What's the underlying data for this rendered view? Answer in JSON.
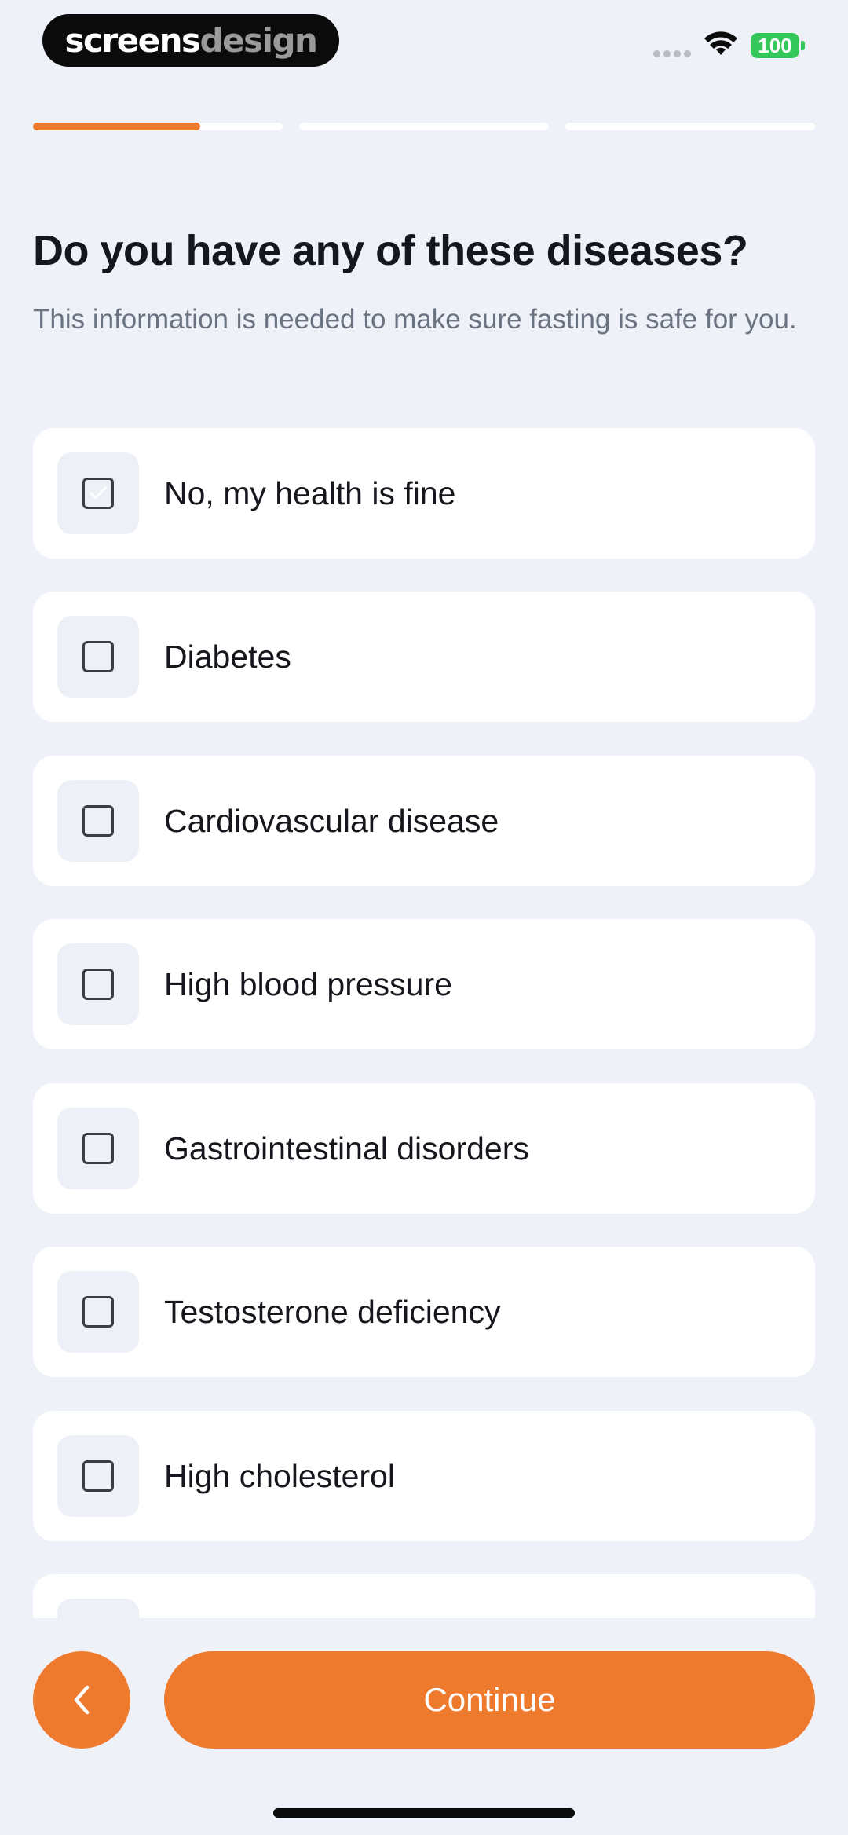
{
  "status_bar": {
    "brand_part1": "screens",
    "brand_part2": "design",
    "battery_level": "100",
    "icons": [
      "signal-dots-icon",
      "wifi-icon",
      "battery-icon"
    ]
  },
  "progress": {
    "segments": 3,
    "current_segment_fill": 0.67,
    "accent_color": "#EE7A2E"
  },
  "question": {
    "title": "Do you have any of these diseases?",
    "subtitle": "This information is needed to make sure fasting is safe for you."
  },
  "options": [
    {
      "label": "No, my health is fine",
      "checked": true
    },
    {
      "label": "Diabetes",
      "checked": false
    },
    {
      "label": "Cardiovascular disease",
      "checked": false
    },
    {
      "label": "High blood pressure",
      "checked": false
    },
    {
      "label": "Gastrointestinal disorders",
      "checked": false
    },
    {
      "label": "Testosterone deficiency",
      "checked": false
    },
    {
      "label": "High cholesterol",
      "checked": false
    },
    {
      "label": "",
      "checked": false
    }
  ],
  "footer": {
    "back_icon": "chevron-left-icon",
    "continue_label": "Continue"
  },
  "colors": {
    "accent": "#EE7A2E",
    "background": "#EEF1F8",
    "selected_check_bg": "#FDE3CC"
  }
}
